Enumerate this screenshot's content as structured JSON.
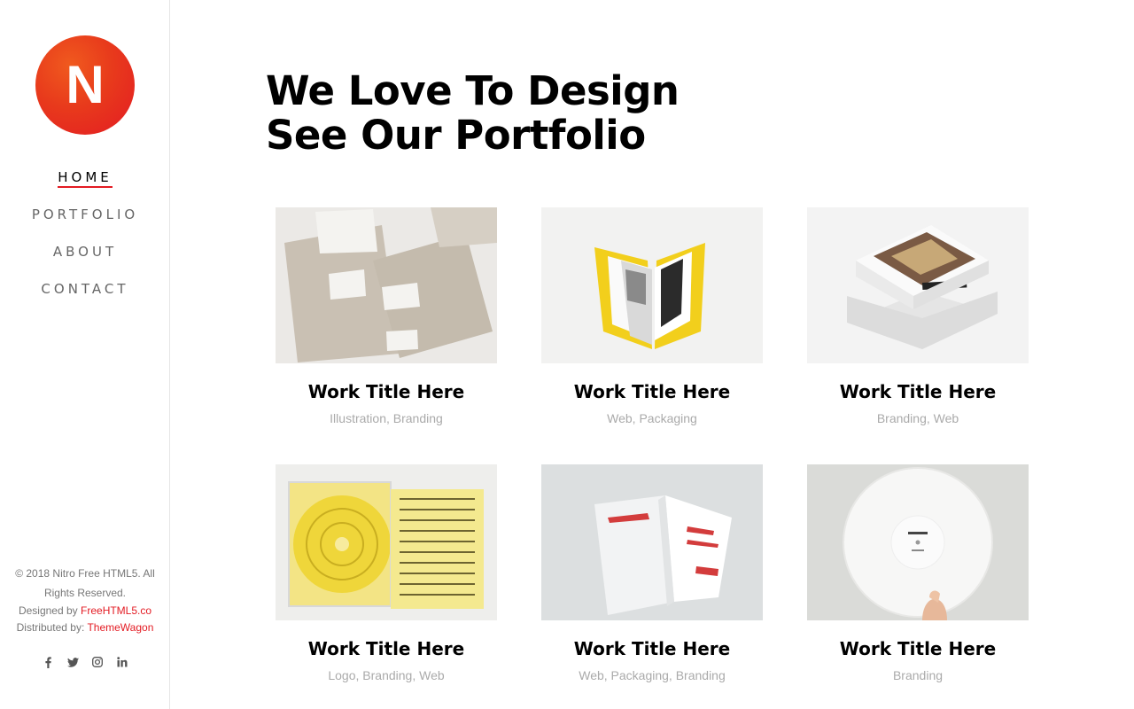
{
  "brand": {
    "logo_letter": "N",
    "accent": "#e31b23"
  },
  "nav": [
    {
      "label": "HOME",
      "active": true
    },
    {
      "label": "PORTFOLIO",
      "active": false
    },
    {
      "label": "ABOUT",
      "active": false
    },
    {
      "label": "CONTACT",
      "active": false
    }
  ],
  "footer": {
    "copyright": "© 2018 Nitro Free HTML5. All Rights Reserved.",
    "designed_prefix": "Designed by",
    "designed_link": "FreeHTML5.co",
    "distributed_prefix": "Distributed by:",
    "distributed_link": "ThemeWagon",
    "social_icons": [
      "facebook-icon",
      "twitter-icon",
      "instagram-icon",
      "linkedin-icon"
    ]
  },
  "headline": {
    "line1": "We Love To Design",
    "line2": "See Our Portfolio"
  },
  "works": [
    {
      "title": "Work Title Here",
      "tags": "Illustration, Branding"
    },
    {
      "title": "Work Title Here",
      "tags": "Web, Packaging"
    },
    {
      "title": "Work Title Here",
      "tags": "Branding, Web"
    },
    {
      "title": "Work Title Here",
      "tags": "Logo, Branding, Web"
    },
    {
      "title": "Work Title Here",
      "tags": "Web, Packaging, Branding"
    },
    {
      "title": "Work Title Here",
      "tags": "Branding"
    }
  ]
}
